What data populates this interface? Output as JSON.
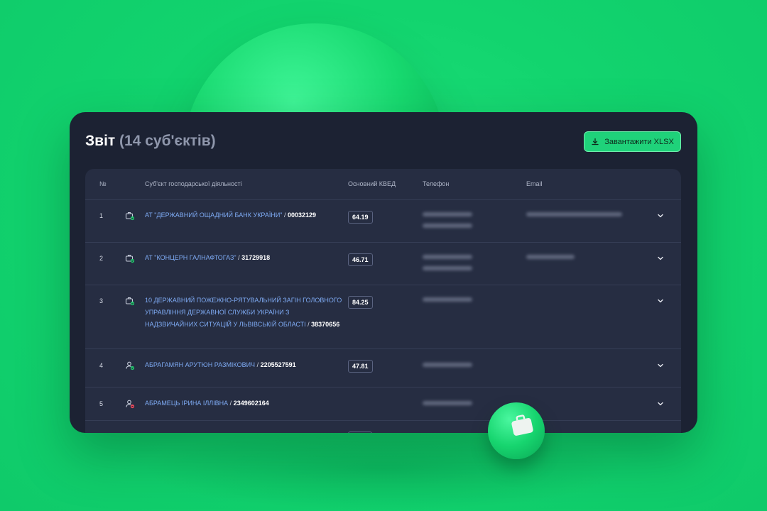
{
  "report": {
    "title": "Звіт",
    "count": "(14 суб'єктів)",
    "download_label": "Завантажити XLSX"
  },
  "table": {
    "headers": {
      "num": "№",
      "entity": "Суб'єкт господарської діяльності",
      "kved": "Основний КВЕД",
      "phone": "Телефон",
      "email": "Email"
    },
    "rows": [
      {
        "num": "1",
        "name": "АТ \"ДЕРЖАВНИЙ ОЩАДНИЙ БАНК УКРАЇНИ\"",
        "code": "00032129",
        "kved": "64.19",
        "type": "company",
        "status": "active"
      },
      {
        "num": "2",
        "name": "АТ \"КОНЦЕРН ГАЛНАФТОГАЗ\"",
        "code": "31729918",
        "kved": "46.71",
        "type": "company",
        "status": "active"
      },
      {
        "num": "3",
        "name": "10 ДЕРЖАВНИЙ ПОЖЕЖНО-РЯТУВАЛЬНИЙ ЗАГІН ГОЛОВНОГО УПРАВЛІННЯ ДЕРЖАВНОЇ СЛУЖБИ УКРАЇНИ З НАДЗВИЧАЙНИХ СИТУАЦІЙ У ЛЬВІВСЬКІЙ ОБЛАСТІ",
        "code": "38370656",
        "kved": "84.25",
        "type": "company",
        "status": "active"
      },
      {
        "num": "4",
        "name": "АБРАГАМЯН АРУТЮН РАЗМІКОВИЧ",
        "code": "2205527591",
        "kved": "47.81",
        "type": "person",
        "status": "active"
      },
      {
        "num": "5",
        "name": "АБРАМЕЦЬ ІРИНА ІЛЛІВНА",
        "code": "2349602164",
        "kved": "",
        "type": "person",
        "status": "inactive"
      }
    ]
  },
  "colors": {
    "accent": "#1fd27a",
    "panel": "#1c2233",
    "table": "#262d42",
    "link": "#7eaaf3",
    "status_active": "#22c86e",
    "status_inactive": "#e5485b"
  },
  "icons": {
    "download": "download-icon",
    "company": "briefcase-status-icon",
    "person": "user-status-icon",
    "expand": "chevron-down-icon",
    "decoration": "briefcase-icon"
  }
}
